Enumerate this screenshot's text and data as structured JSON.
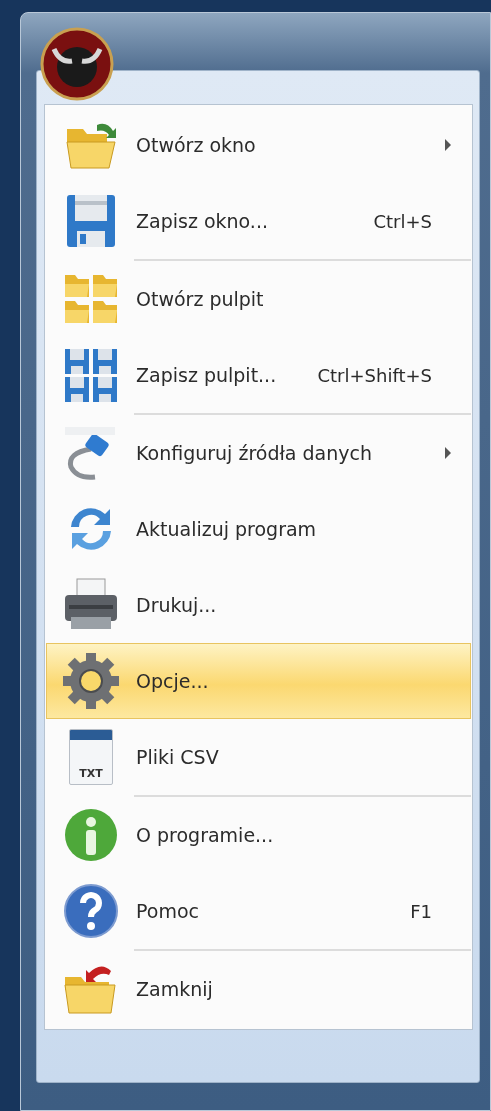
{
  "menu": {
    "items": [
      {
        "kind": "item",
        "label": "Otwórz okno",
        "submenu": true,
        "selected": false
      },
      {
        "kind": "item",
        "label": "Zapisz okno...",
        "shortcut": "Ctrl+S",
        "submenu": false,
        "selected": false
      },
      {
        "kind": "separator"
      },
      {
        "kind": "item",
        "label": "Otwórz pulpit",
        "submenu": false,
        "selected": false
      },
      {
        "kind": "item",
        "label": "Zapisz pulpit...",
        "shortcut": "Ctrl+Shift+S",
        "submenu": false,
        "selected": false
      },
      {
        "kind": "separator"
      },
      {
        "kind": "item",
        "label": "Konfiguruj źródła danych",
        "submenu": true,
        "selected": false
      },
      {
        "kind": "item",
        "label": "Aktualizuj program",
        "submenu": false,
        "selected": false
      },
      {
        "kind": "item",
        "label": "Drukuj...",
        "submenu": false,
        "selected": false
      },
      {
        "kind": "item",
        "label": "Opcje...",
        "submenu": false,
        "selected": true
      },
      {
        "kind": "item",
        "icon_label": "TXT",
        "label": "Pliki CSV",
        "submenu": false,
        "selected": false
      },
      {
        "kind": "separator"
      },
      {
        "kind": "item",
        "label": "O programie...",
        "submenu": false,
        "selected": false
      },
      {
        "kind": "item",
        "label": "Pomoc",
        "shortcut": "F1",
        "submenu": false,
        "selected": false
      },
      {
        "kind": "separator"
      },
      {
        "kind": "item",
        "label": "Zamknij",
        "submenu": false,
        "selected": false
      }
    ]
  }
}
